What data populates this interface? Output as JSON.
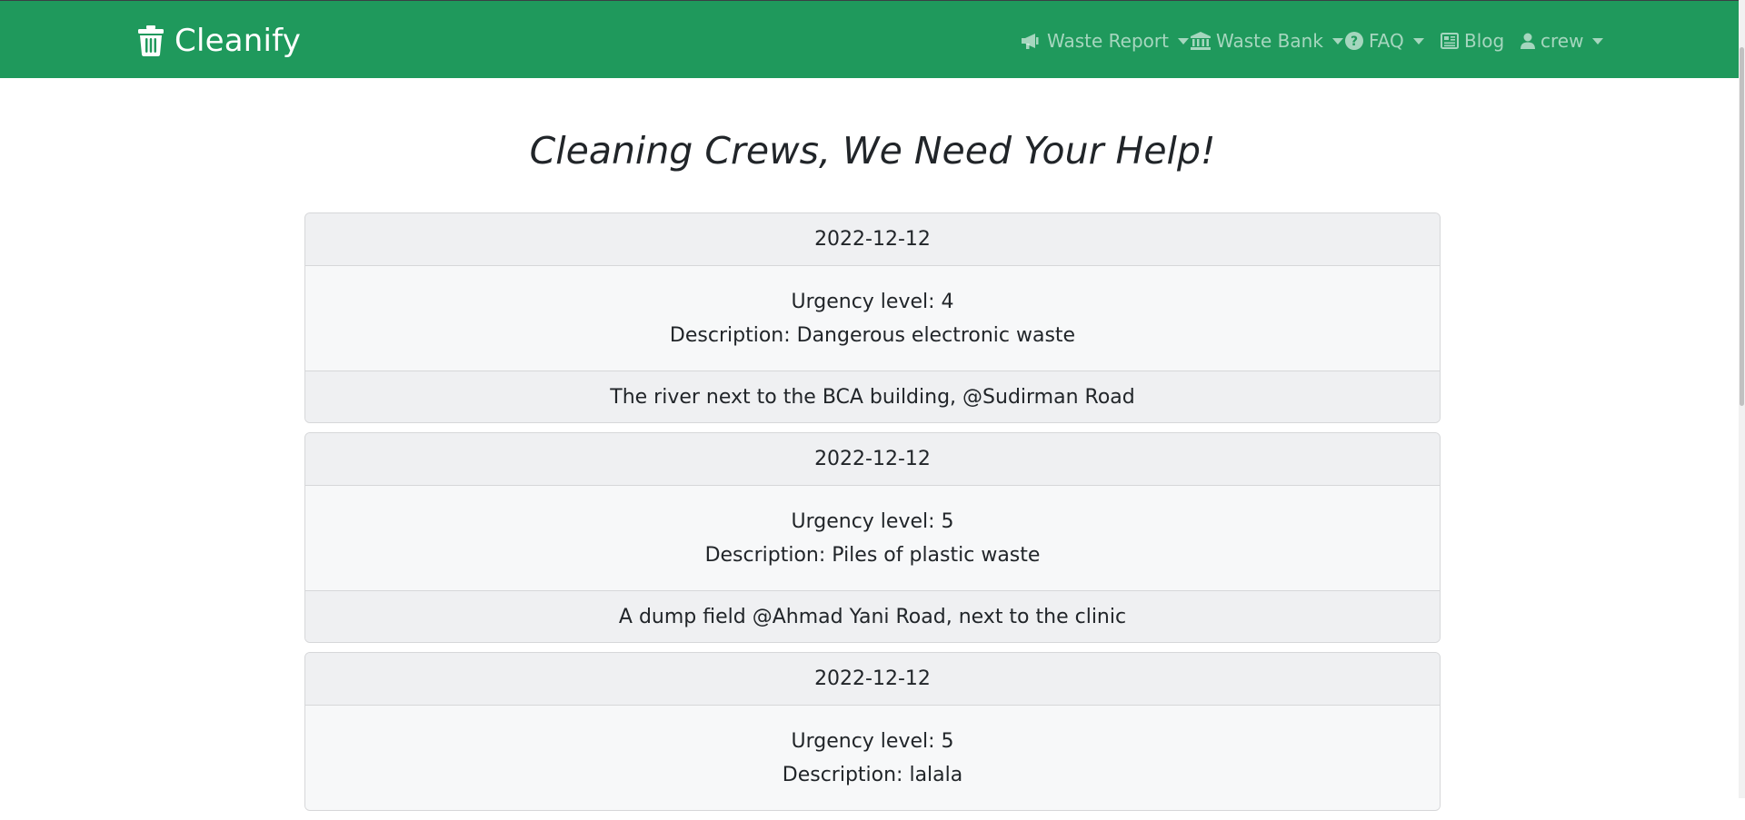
{
  "brand": {
    "name": "Cleanify",
    "icon": "trash-icon"
  },
  "colors": {
    "navbar": "#1f995c",
    "nav_text": "rgba(255,255,255,0.6)"
  },
  "nav": {
    "waste_report": {
      "label": "Waste Report",
      "icon": "megaphone-icon"
    },
    "waste_bank": {
      "label": "Waste Bank",
      "icon": "bank-icon"
    },
    "faq": {
      "label": "FAQ",
      "icon": "question-circle-icon"
    },
    "blog": {
      "label": "Blog",
      "icon": "newspaper-icon"
    },
    "user": {
      "label": "crew",
      "icon": "user-icon"
    }
  },
  "page": {
    "title": "Cleaning Crews, We Need Your Help!"
  },
  "reports": [
    {
      "date": "2022-12-12",
      "urgency": "Urgency level: 4",
      "description": "Description: Dangerous electronic waste",
      "location": "The river next to the BCA building, @Sudirman Road"
    },
    {
      "date": "2022-12-12",
      "urgency": "Urgency level: 5",
      "description": "Description: Piles of plastic waste",
      "location": "A dump field @Ahmad Yani Road, next to the clinic"
    },
    {
      "date": "2022-12-12",
      "urgency": "Urgency level: 5",
      "description": "Description: lalala"
    }
  ]
}
